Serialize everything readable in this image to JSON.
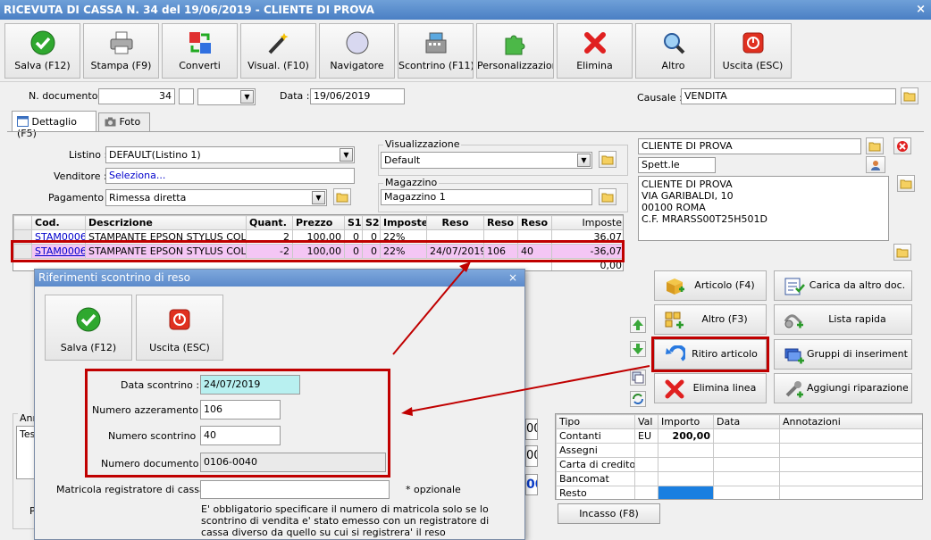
{
  "window": {
    "title": "RICEVUTA DI CASSA N. 34 del 19/06/2019 - CLIENTE DI PROVA",
    "close": "×"
  },
  "toolbar": [
    {
      "label": "Salva (F12)",
      "icon": "check-icon"
    },
    {
      "label": "Stampa (F9)",
      "icon": "printer-icon"
    },
    {
      "label": "Converti",
      "icon": "convert-icon"
    },
    {
      "label": "Visual. (F10)",
      "icon": "magic-wand-icon"
    },
    {
      "label": "Navigatore",
      "icon": "compass-icon"
    },
    {
      "label": "Scontrino (F11)",
      "icon": "cash-register-icon"
    },
    {
      "label": "Personalizzazioni",
      "icon": "puzzle-icon"
    },
    {
      "label": "Elimina",
      "icon": "delete-x-icon"
    },
    {
      "label": "Altro",
      "icon": "magnifier-icon"
    },
    {
      "label": "Uscita (ESC)",
      "icon": "power-icon"
    }
  ],
  "header": {
    "ndoc_label": "N. documento :",
    "ndoc_value": "34",
    "data_label": "Data :",
    "data_value": "19/06/2019",
    "causale_label": "Causale :",
    "causale_value": "VENDITA"
  },
  "tabs": [
    {
      "label": "Dettaglio (F5)"
    },
    {
      "label": "Foto"
    }
  ],
  "form": {
    "listino_label": "Listino :",
    "listino_value": "DEFAULT(Listino 1)",
    "venditore_label": "Venditore :",
    "venditore_value": "Seleziona...",
    "pagamento_label": "Pagamento :",
    "pagamento_value": "Rimessa diretta",
    "visualizzazione_label": "Visualizzazione",
    "visualizzazione_value": "Default",
    "magazzino_label": "Magazzino",
    "magazzino_value": "Magazzino 1"
  },
  "cliente": {
    "name": "CLIENTE DI PROVA",
    "greeting": "Spett.le",
    "address": [
      "CLIENTE DI PROVA",
      "VIA GARIBALDI, 10",
      "00100 ROMA",
      "C.F. MRARSS00T25H501D"
    ]
  },
  "grid": {
    "headers": [
      "Cod.",
      "Descrizione",
      "Quant.",
      "Prezzo",
      "S1",
      "S2",
      "Imposte",
      "Reso",
      "Reso",
      "Reso",
      "Imposte"
    ],
    "rows": [
      [
        "STAM0006",
        "STAMPANTE EPSON STYLUS COLOR",
        "2",
        "100,00",
        "0",
        "0",
        "22%",
        "",
        "",
        "",
        "36,07"
      ],
      [
        "STAM0006",
        "STAMPANTE EPSON STYLUS COLOR",
        "-2",
        "100,00",
        "0",
        "0",
        "22%",
        "24/07/2019",
        "106",
        "40",
        "-36,07"
      ]
    ],
    "total": "0,00"
  },
  "side_buttons": [
    {
      "label": "Articolo (F4)",
      "icon": "add-article-icon"
    },
    {
      "label": "Carica da altro doc.",
      "icon": "load-doc-icon"
    },
    {
      "label": "Altro (F3)",
      "icon": "add-grid-icon"
    },
    {
      "label": "Lista rapida",
      "icon": "quick-list-icon"
    },
    {
      "label": "Ritiro articolo",
      "icon": "return-arrow-icon"
    },
    {
      "label": "Gruppi di inserimento",
      "icon": "group-insert-icon"
    },
    {
      "label": "Elimina linea",
      "icon": "delete-x-icon"
    },
    {
      "label": "Aggiungi riparazione",
      "icon": "wrench-icon"
    }
  ],
  "payments": {
    "headers": [
      "Tipo",
      "Val",
      "Importo",
      "Data",
      "Annotazioni"
    ],
    "rows": [
      [
        "Contanti",
        "EU",
        "200,00",
        "",
        ""
      ],
      [
        "Assegni",
        "",
        "",
        "",
        ""
      ],
      [
        "Carta di credito",
        "",
        "",
        "",
        ""
      ],
      [
        "Bancomat",
        "",
        "",
        "",
        ""
      ],
      [
        "Resto",
        "",
        "",
        "",
        ""
      ]
    ],
    "incasso_label": "Incasso (F8)"
  },
  "behind": {
    "annotazioni_stub": "Anı",
    "testo_stub": "Tes",
    "p_stub": "P",
    "zero_stub": "00"
  },
  "dialog": {
    "title": "Riferimenti scontrino di reso",
    "close": "×",
    "save_label": "Salva (F12)",
    "exit_label": "Uscita (ESC)",
    "data_scontrino_label": "Data scontrino :",
    "data_scontrino_value": "24/07/2019",
    "num_azzer_label": "Numero azzeramento :",
    "num_azzer_value": "106",
    "num_scontrino_label": "Numero scontrino :",
    "num_scontrino_value": "40",
    "num_doc_label": "Numero documento :",
    "num_doc_value": "0106-0040",
    "matricola_label": "Matricola registratore di cassa :",
    "matricola_value": "",
    "opzionale": "* opzionale",
    "note": "E' obbligatorio specificare il numero di matricola solo se lo scontrino di vendita e' stato emesso con un registratore di cassa diverso da quello su cui si registrera' il reso"
  },
  "colors": {
    "highlight_row": "#f4c6f4",
    "accent_red": "#c00000",
    "cyan_field": "#b8f0f0",
    "blue_cell": "#1a7fe0"
  }
}
